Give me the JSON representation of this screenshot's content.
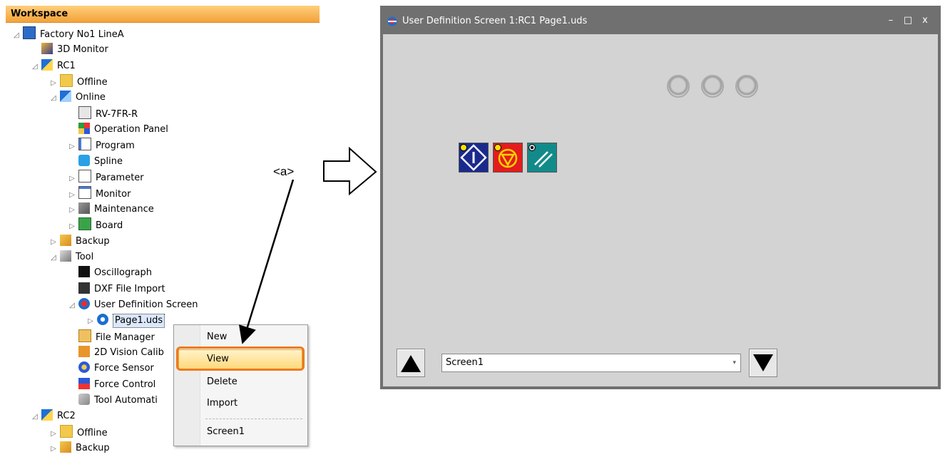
{
  "workspace": {
    "title": "Workspace",
    "tree": [
      {
        "label": "Factory No1 LineA",
        "icon": "project-icon",
        "indent": 0,
        "toggle": "expanded"
      },
      {
        "label": "3D Monitor",
        "icon": "3d-monitor-icon",
        "indent": 1,
        "toggle": "none"
      },
      {
        "label": "RC1",
        "icon": "robot-controller-icon",
        "indent": 1,
        "toggle": "expanded"
      },
      {
        "label": "Offline",
        "icon": "offline-icon",
        "indent": 2,
        "toggle": "collapsed"
      },
      {
        "label": "Online",
        "icon": "online-icon",
        "indent": 2,
        "toggle": "expanded"
      },
      {
        "label": "RV-7FR-R",
        "icon": "robot-model-icon",
        "indent": 3,
        "toggle": "none"
      },
      {
        "label": "Operation Panel",
        "icon": "operation-panel-icon",
        "indent": 3,
        "toggle": "none"
      },
      {
        "label": "Program",
        "icon": "program-icon",
        "indent": 3,
        "toggle": "collapsed"
      },
      {
        "label": "Spline",
        "icon": "spline-icon",
        "indent": 3,
        "toggle": "none"
      },
      {
        "label": "Parameter",
        "icon": "parameter-icon",
        "indent": 3,
        "toggle": "collapsed"
      },
      {
        "label": "Monitor",
        "icon": "monitor-icon",
        "indent": 3,
        "toggle": "collapsed"
      },
      {
        "label": "Maintenance",
        "icon": "maintenance-icon",
        "indent": 3,
        "toggle": "collapsed"
      },
      {
        "label": "Board",
        "icon": "board-icon",
        "indent": 3,
        "toggle": "collapsed"
      },
      {
        "label": "Backup",
        "icon": "backup-icon",
        "indent": 2,
        "toggle": "collapsed"
      },
      {
        "label": "Tool",
        "icon": "tool-icon",
        "indent": 2,
        "toggle": "expanded"
      },
      {
        "label": "Oscillograph",
        "icon": "oscillograph-icon",
        "indent": 3,
        "toggle": "none"
      },
      {
        "label": "DXF File Import",
        "icon": "dxf-import-icon",
        "indent": 3,
        "toggle": "none"
      },
      {
        "label": "User Definition Screen",
        "icon": "user-definition-screen-icon",
        "indent": 3,
        "toggle": "expanded"
      },
      {
        "label": "Page1.uds",
        "icon": "page-icon",
        "indent": 4,
        "toggle": "collapsed",
        "selected": true
      },
      {
        "label": "File Manager",
        "icon": "file-manager-icon",
        "indent": 3,
        "toggle": "none"
      },
      {
        "label": "2D Vision Calib",
        "icon": "vision-calibration-icon",
        "indent": 3,
        "toggle": "none"
      },
      {
        "label": "Force Sensor",
        "icon": "force-sensor-icon",
        "indent": 3,
        "toggle": "none"
      },
      {
        "label": "Force Control",
        "icon": "force-control-icon",
        "indent": 3,
        "toggle": "none"
      },
      {
        "label": "Tool Automati",
        "icon": "tool-automation-icon",
        "indent": 3,
        "toggle": "none"
      },
      {
        "label": "RC2",
        "icon": "robot-controller-icon",
        "indent": 1,
        "toggle": "expanded"
      },
      {
        "label": "Offline",
        "icon": "offline-icon",
        "indent": 2,
        "toggle": "collapsed"
      },
      {
        "label": "Backup",
        "icon": "backup-icon",
        "indent": 2,
        "toggle": "collapsed"
      }
    ]
  },
  "context_menu": {
    "items": [
      {
        "label": "New",
        "highlighted": false
      },
      {
        "label": "View",
        "highlighted": true
      },
      {
        "label": "Delete",
        "highlighted": false
      },
      {
        "label": "Import",
        "highlighted": false
      },
      {
        "label": "Screen1",
        "highlighted": false
      }
    ]
  },
  "annotation": {
    "label": "<a>"
  },
  "dialog": {
    "title": "User Definition Screen 1:RC1 Page1.uds",
    "window_buttons": [
      "–",
      "□",
      "x"
    ],
    "screen_select": {
      "value": "Screen1"
    },
    "lamp_count": 3,
    "buttons": [
      {
        "name": "start-button",
        "color": "#1a2a8c"
      },
      {
        "name": "stop-button",
        "color": "#e31d1d"
      },
      {
        "name": "reset-button",
        "color": "#138a8a"
      }
    ]
  },
  "colors": {
    "header": "#f3a23a",
    "highlight_ring": "#ee7a1e",
    "dialog_frame": "#707070",
    "dialog_body": "#d3d3d3"
  }
}
